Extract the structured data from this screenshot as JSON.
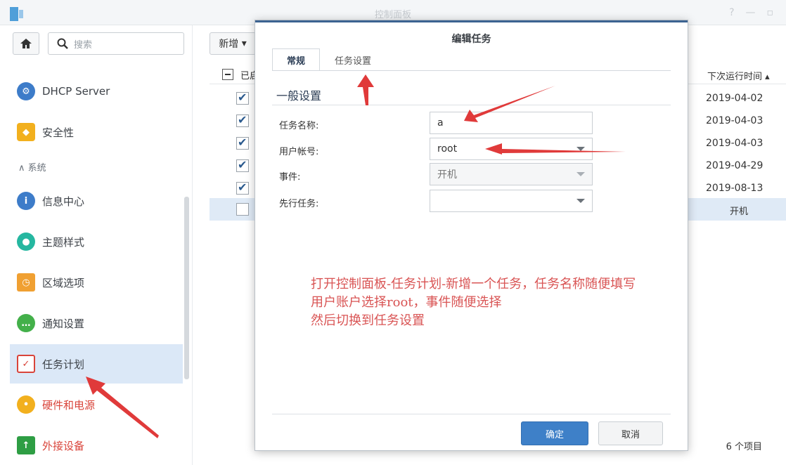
{
  "window": {
    "title": "控制面板"
  },
  "sidebar": {
    "search_placeholder": "搜索",
    "section_system": "系统",
    "items": [
      {
        "label": "DHCP Server",
        "icon": "dhcp-icon",
        "color": "#3d7cc9"
      },
      {
        "label": "安全性",
        "icon": "shield-icon",
        "color": "#f2b01e"
      },
      {
        "label": "信息中心",
        "icon": "info-icon",
        "color": "#3d7cc9"
      },
      {
        "label": "主题样式",
        "icon": "palette-icon",
        "color": "#25b7a0"
      },
      {
        "label": "区域选项",
        "icon": "region-icon",
        "color": "#f0a032"
      },
      {
        "label": "通知设置",
        "icon": "chat-icon",
        "color": "#43b04a"
      },
      {
        "label": "任务计划",
        "icon": "calendar-icon",
        "color": "#d9443a"
      },
      {
        "label": "硬件和电源",
        "icon": "bulb-icon",
        "color": "#f2b01e"
      },
      {
        "label": "外接设备",
        "icon": "upload-icon",
        "color": "#2e9e44"
      }
    ]
  },
  "toolbar": {
    "new_label": "新增"
  },
  "table": {
    "col_enabled": "已启",
    "col_next_run": "下次运行时间",
    "rows": [
      {
        "checked": true,
        "next": "2019-04-02"
      },
      {
        "checked": true,
        "next": "2019-04-03"
      },
      {
        "checked": true,
        "next": "2019-04-03"
      },
      {
        "checked": true,
        "next": "2019-04-29"
      },
      {
        "checked": true,
        "next": "2019-08-13"
      },
      {
        "checked": false,
        "next": "开机"
      }
    ],
    "count": "6 个项目"
  },
  "dialog": {
    "title": "编辑任务",
    "tabs": [
      "常规",
      "任务设置"
    ],
    "section": "一般设置",
    "fields": {
      "name_label": "任务名称:",
      "name_value": "a",
      "user_label": "用户帐号:",
      "user_value": "root",
      "event_label": "事件:",
      "event_value": "开机",
      "prereq_label": "先行任务:",
      "prereq_value": ""
    },
    "ok": "确定",
    "cancel": "取消"
  },
  "annotation": {
    "line1": "打开控制面板-任务计划-新增一个任务，任务名称随便填写",
    "line2": "用户账户选择root，事件随便选择",
    "line3": "然后切换到任务设置"
  },
  "colors": {
    "accent": "#3e80c8",
    "annotation": "#d95454"
  }
}
